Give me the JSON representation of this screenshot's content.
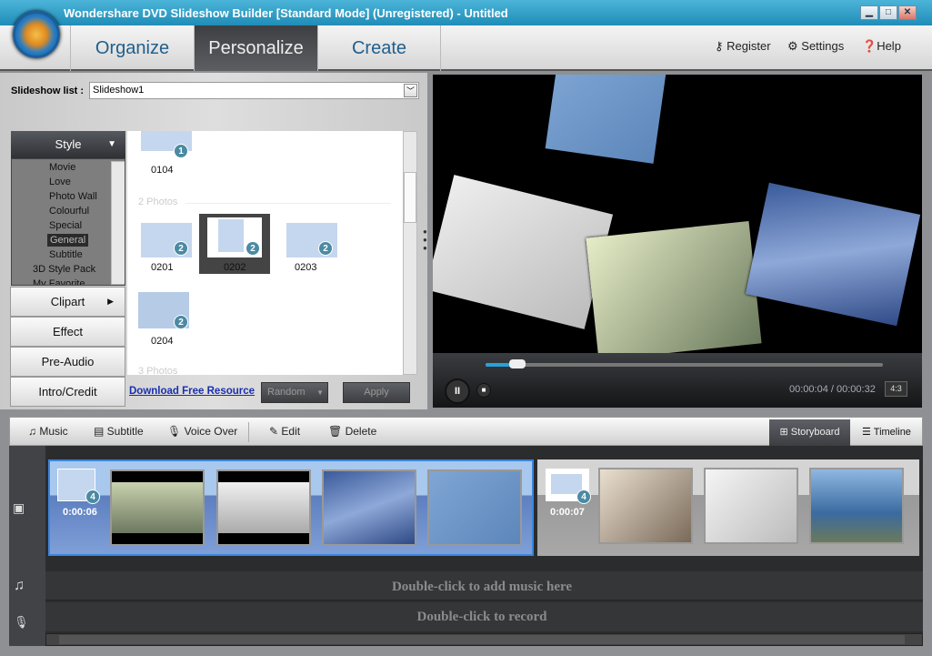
{
  "window": {
    "title": "Wondershare DVD Slideshow Builder [Standard Mode] (Unregistered) - Untitled",
    "buttons": [
      "minimize",
      "maximize",
      "close"
    ]
  },
  "tabs": [
    {
      "label": "Organize",
      "active": false
    },
    {
      "label": "Personalize",
      "active": true
    },
    {
      "label": "Create",
      "active": false
    }
  ],
  "top_links": {
    "register": "Register",
    "settings": "Settings",
    "help": "Help"
  },
  "slideshow_list": {
    "label": "Slideshow list :",
    "value": "Slideshow1"
  },
  "style_panel": {
    "header": "Style",
    "tree": [
      "Movie",
      "Love",
      "Photo Wall",
      "Colourful",
      "Special",
      "General",
      "Subtitle",
      "3D Style Pack",
      "My Favorite"
    ],
    "selected": "General"
  },
  "side_buttons": [
    "Clipart",
    "Effect",
    "Pre-Audio",
    "Intro/Credit"
  ],
  "gallery": {
    "items": [
      {
        "id": "0104",
        "count": "1"
      },
      {
        "id": "0201",
        "count": "2"
      },
      {
        "id": "0202",
        "count": "2",
        "selected": true
      },
      {
        "id": "0203",
        "count": "2"
      },
      {
        "id": "0204",
        "count": "2"
      }
    ],
    "sections": [
      "2 Photos",
      "3 Photos"
    ],
    "download_link": "Download Free Resource",
    "random": "Random",
    "apply": "Apply"
  },
  "player": {
    "time": "00:00:04 / 00:00:32",
    "aspect": "4:3",
    "progress_percent": 8,
    "accent": "#2aa0d8"
  },
  "toolbar": {
    "music": "Music",
    "subtitle": "Subtitle",
    "voice_over": "Voice Over",
    "edit": "Edit",
    "delete": "Delete",
    "storyboard": "Storyboard",
    "timeline": "Timeline"
  },
  "storyboard": {
    "groups": [
      {
        "duration": "0:00:06",
        "count": "4",
        "selected": true
      },
      {
        "duration": "0:00:07",
        "count": "4",
        "selected": false
      }
    ],
    "music_hint": "Double-click to add music here",
    "record_hint": "Double-click to record"
  }
}
